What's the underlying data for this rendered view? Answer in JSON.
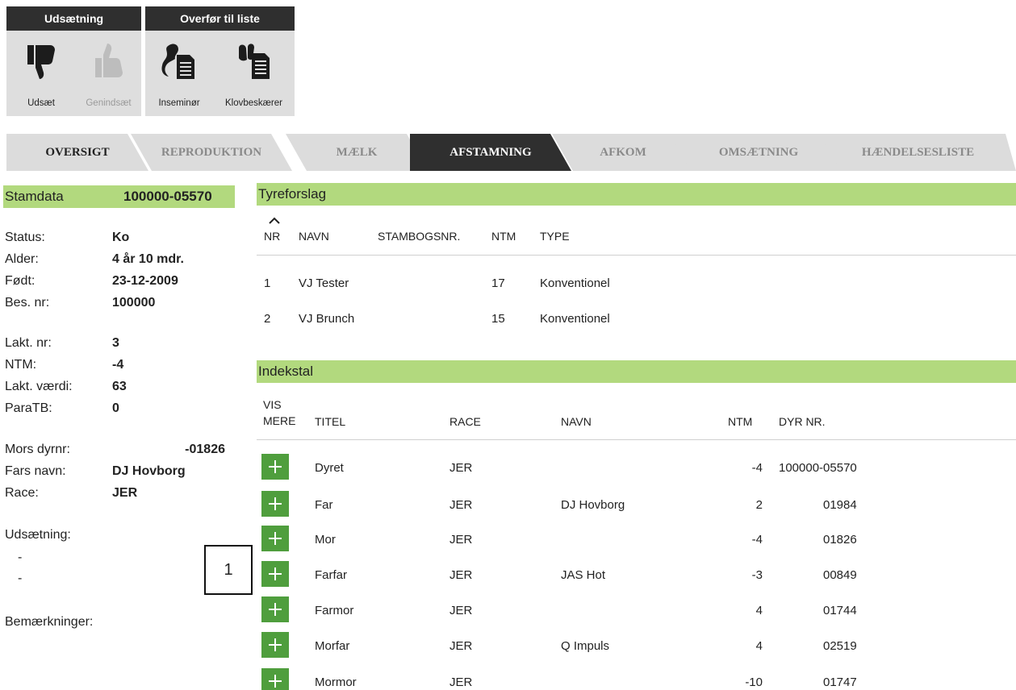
{
  "toolbar": {
    "groups": [
      {
        "title": "Udsætning",
        "buttons": [
          {
            "label": "Udsæt",
            "icon": "thumbs-down-icon",
            "enabled": true
          },
          {
            "label": "Genindsæt",
            "icon": "thumbs-up-icon",
            "enabled": false
          }
        ]
      },
      {
        "title": "Overfør til liste",
        "buttons": [
          {
            "label": "Inseminør",
            "icon": "inseminator-list-icon",
            "enabled": true
          },
          {
            "label": "Klovbeskærer",
            "icon": "hoof-trimmer-list-icon",
            "enabled": true
          }
        ]
      }
    ]
  },
  "tabs": [
    "OVERSIGT",
    "REPRODUKTION",
    "MÆLK",
    "AFSTAMNING",
    "AFKOM",
    "OMSÆTNING",
    "HÆNDELSESLISTE"
  ],
  "active_tab": "AFSTAMNING",
  "stamdata": {
    "title": "Stamdata",
    "id": "100000-05570",
    "group1": [
      {
        "label": "Status:",
        "value": "Ko"
      },
      {
        "label": "Alder:",
        "value": "4 år 10 mdr."
      },
      {
        "label": "Født:",
        "value": "23-12-2009"
      },
      {
        "label": "Bes. nr:",
        "value": "100000"
      }
    ],
    "group2": [
      {
        "label": "Lakt. nr:",
        "value": "3"
      },
      {
        "label": "NTM:",
        "value": "-4"
      },
      {
        "label": "Lakt. værdi:",
        "value": "63"
      },
      {
        "label": "ParaTB:",
        "value": "0"
      }
    ],
    "group3": [
      {
        "label": "Mors dyrnr:",
        "value": "-01826"
      },
      {
        "label": "Fars navn:",
        "value": "DJ Hovborg"
      },
      {
        "label": "Race:",
        "value": "JER"
      }
    ],
    "udsaetning_label": "Udsætning:",
    "udsaetning_values": [
      "-",
      "-"
    ],
    "bemaerkninger_label": "Bemærkninger:"
  },
  "tyreforslag": {
    "title": "Tyreforslag",
    "columns": [
      "NR",
      "NAVN",
      "STAMBOGSNR.",
      "NTM",
      "TYPE"
    ],
    "sort_indicator": "^",
    "rows": [
      {
        "nr": "1",
        "navn": "VJ Tester",
        "ntm": "17",
        "type": "Konventionel"
      },
      {
        "nr": "2",
        "navn": "VJ Brunch",
        "ntm": "15",
        "type": "Konventionel"
      }
    ]
  },
  "indekstal": {
    "title": "Indekstal",
    "columns": {
      "vis_mere_1": "VIS",
      "vis_mere_2": "MERE",
      "titel": "TITEL",
      "race": "RACE",
      "navn": "NAVN",
      "ntm": "NTM",
      "dyr_nr": "DYR NR."
    },
    "rows": [
      {
        "titel": "Dyret",
        "race": "JER",
        "navn": "",
        "ntm": "-4",
        "dyr_nr": "100000-05570"
      },
      {
        "titel": "Far",
        "race": "JER",
        "navn": "DJ Hovborg",
        "ntm": "2",
        "dyr_nr": "01984"
      },
      {
        "titel": "Mor",
        "race": "JER",
        "navn": "",
        "ntm": "-4",
        "dyr_nr": "01826"
      },
      {
        "titel": "Farfar",
        "race": "JER",
        "navn": "JAS Hot",
        "ntm": "-3",
        "dyr_nr": "00849"
      },
      {
        "titel": "Farmor",
        "race": "JER",
        "navn": "",
        "ntm": "4",
        "dyr_nr": "01744"
      },
      {
        "titel": "Morfar",
        "race": "JER",
        "navn": "Q Impuls",
        "ntm": "4",
        "dyr_nr": "02519"
      },
      {
        "titel": "Mormor",
        "race": "JER",
        "navn": "",
        "ntm": "-10",
        "dyr_nr": "01747"
      }
    ]
  },
  "callout_label": "1",
  "colors": {
    "accent_green": "#b2d97e",
    "plus_button": "#4f9e3d",
    "tab_active": "#2f2f2f",
    "tab_inactive": "#dcdcdc"
  }
}
